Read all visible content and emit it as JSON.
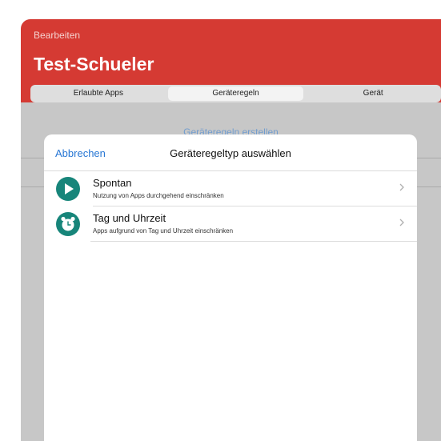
{
  "header": {
    "edit_label": "Bearbeiten",
    "title": "Test-Schueler",
    "accent_color": "#d53a33"
  },
  "tabs": [
    {
      "label": "Erlaubte Apps"
    },
    {
      "label": "Geräteregeln",
      "selected": true
    },
    {
      "label": "Gerät"
    }
  ],
  "background": {
    "link_text": "Geräteregeln erstellen"
  },
  "modal": {
    "cancel_label": "Abbrechen",
    "title": "Geräteregeltyp auswählen",
    "options": [
      {
        "title": "Spontan",
        "subtitle": "Nutzung von Apps durchgehend einschränken",
        "icon": "play-icon",
        "icon_color": "#17857a"
      },
      {
        "title": "Tag und Uhrzeit",
        "subtitle": "Apps aufgrund von Tag und Uhrzeit einschränken",
        "icon": "alarm-clock-icon",
        "icon_color": "#17857a"
      }
    ]
  }
}
